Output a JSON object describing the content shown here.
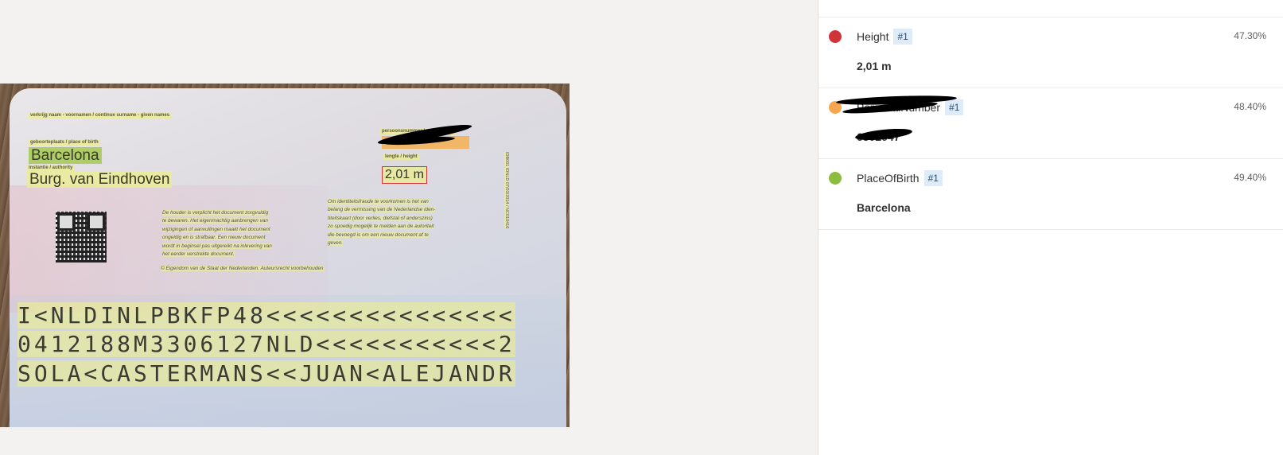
{
  "document": {
    "label_surname": "verkrijg naam - voornamen / continue surname - given names",
    "label_place_of_birth": "geboorteplaats / place of birth",
    "place_of_birth": "Barcelona",
    "label_authority": "instantie / authority",
    "authority": "Burg. van Eindhoven",
    "label_personal_number": "persoonsnummer / personal no.",
    "label_height": "lengte / height",
    "height": "2,01 m",
    "paragraph_1": [
      "De houder is verplicht het document zorgvuldig",
      "te bewaren. Het eigenmachtig aanbrengen van",
      "wijzigingen of aanvullingen maakt het document",
      "ongeldig en is strafbaar. Een nieuw document",
      "wordt in beginsel pas uitgereikt na inlevering van",
      "het eerder verstrekte document."
    ],
    "paragraph_2": [
      "Om identiteitsfraude te voorkomen is het van",
      "belang de vermissing van de Nederlandse iden-",
      "titeitskaart (door verlies, diefstal of anderszins)",
      "zo spoedig mogelijk te melden aan de autoriteit",
      "die bevoegd is om een nieuw document af te",
      "geven."
    ],
    "ownership": "© Eigendom van de Staat der Nederlanden. Auteursrecht voorbehouden",
    "side_code": "IDB001 IDNLD 07/03/2014 / NC010416",
    "mrz": [
      "I<NLDINLPBKFP48<<<<<<<<<<<<<<<",
      "0412188M3306127NLD<<<<<<<<<<<2",
      "SOLA<CASTERMANS<<JUAN<ALEJANDR"
    ]
  },
  "fields": [
    {
      "name": "Height",
      "tag": "#1",
      "confidence": "47.30%",
      "value": "2,01 m",
      "color": "#d13438"
    },
    {
      "name": "PersonalNumber",
      "tag": "#1",
      "confidence": "48.40%",
      "value": "6502047",
      "color": "#f7a650"
    },
    {
      "name": "PlaceOfBirth",
      "tag": "#1",
      "confidence": "49.40%",
      "value": "Barcelona",
      "color": "#8cbd3e"
    }
  ]
}
